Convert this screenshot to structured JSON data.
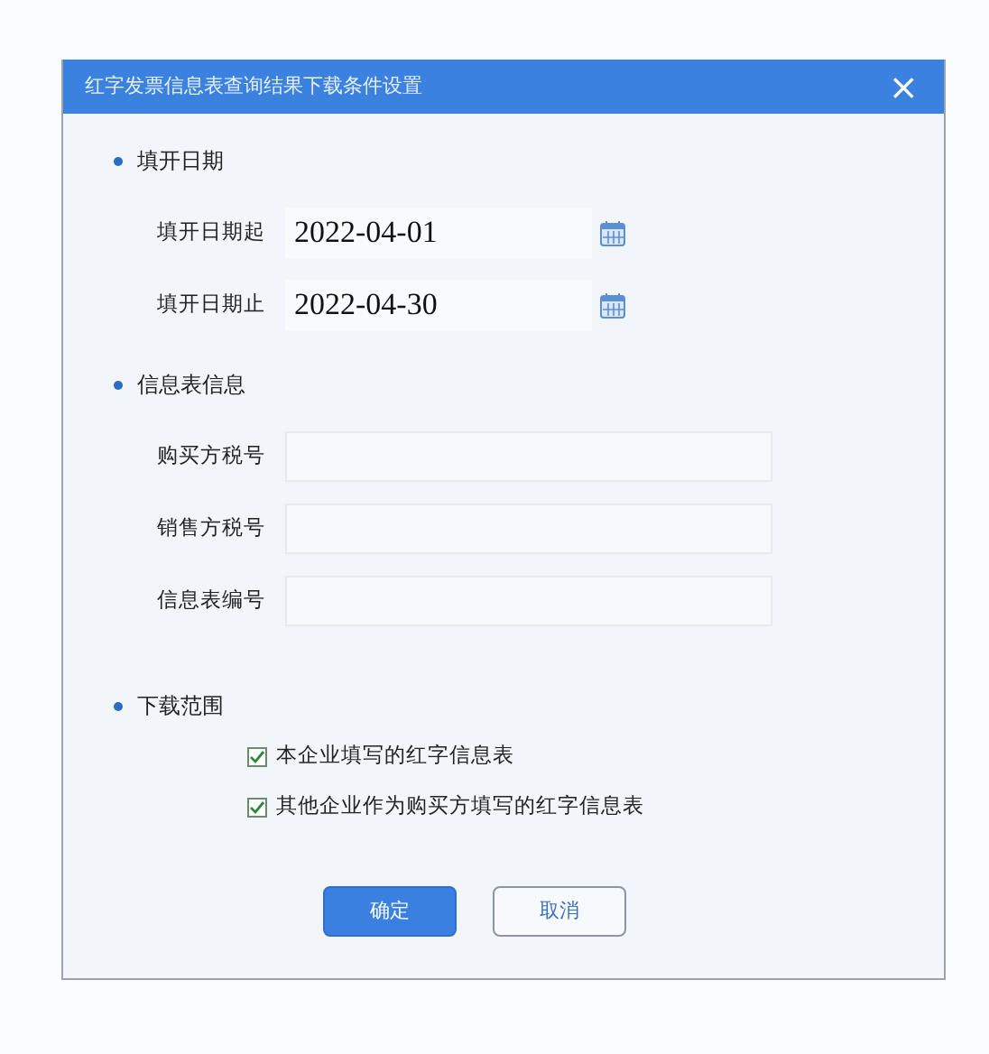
{
  "window": {
    "title": "红字发票信息表查询结果下载条件设置",
    "close": "×"
  },
  "sections": [
    {
      "title": "填开日期",
      "kind": "date",
      "fields": [
        {
          "label": "填开日期起",
          "value": "2022-04-01"
        },
        {
          "label": "填开日期止",
          "value": "2022-04-30"
        }
      ]
    },
    {
      "title": "信息表信息",
      "kind": "text",
      "fields": [
        {
          "label": "购买方税号"
        },
        {
          "label": "销售方税号"
        },
        {
          "label": "信息表编号"
        }
      ]
    },
    {
      "title": "下载范围",
      "kind": "checks",
      "options": [
        {
          "label": "本企业填写的红字信息表",
          "checked": true
        },
        {
          "label": "其他企业作为购买方填写的红字信息表",
          "checked": true
        }
      ]
    }
  ],
  "buttons": [
    {
      "label": "确定",
      "kind": "primary"
    },
    {
      "label": "取消",
      "kind": "secondary"
    }
  ]
}
